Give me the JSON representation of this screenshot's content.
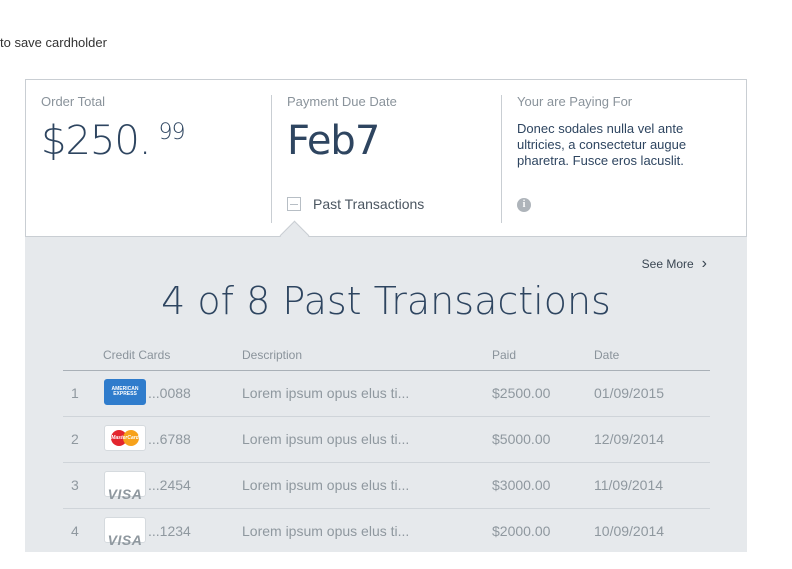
{
  "top_note": "to save cardholder",
  "summary": {
    "order_total_label": "Order Total",
    "order_total_main": "$250.",
    "order_total_cents": "99",
    "due_label": "Payment Due Date",
    "due_value": "Feb7",
    "past_toggle_label": "Past Transactions",
    "paying_label": "Your are Paying For",
    "paying_text": "Donec sodales nulla vel ante ultricies, a consectetur augue pharetra. Fusce eros lacuslit.",
    "info_icon": "info-icon",
    "info_glyph": "i"
  },
  "history": {
    "see_more": "See More",
    "see_more_chevron": ">",
    "title": "4 of 8 Past Transactions",
    "columns": [
      "Credit Cards",
      "Description",
      "Paid",
      "Date"
    ],
    "rows": [
      {
        "num": "1",
        "card": "amex",
        "card_text": "AMERICAN EXPRESS",
        "digits": "...0088",
        "desc": "Lorem ipsum opus elus ti...",
        "paid": "$2500.00",
        "date": "01/09/2015"
      },
      {
        "num": "2",
        "card": "mastercard",
        "card_text": "MasterCard",
        "digits": "...6788",
        "desc": "Lorem ipsum opus elus ti...",
        "paid": "$5000.00",
        "date": "12/09/2014"
      },
      {
        "num": "3",
        "card": "visa",
        "card_text": "VISA",
        "digits": "...2454",
        "desc": "Lorem ipsum opus elus ti...",
        "paid": "$3000.00",
        "date": "11/09/2014"
      },
      {
        "num": "4",
        "card": "visa",
        "card_text": "VISA",
        "digits": "...1234",
        "desc": "Lorem ipsum opus elus ti...",
        "paid": "$2000.00",
        "date": "10/09/2014"
      }
    ]
  },
  "colors": {
    "panel_bg": "#e6e9ec",
    "heading": "#2e4560",
    "muted": "#8f989f",
    "border": "#c9ced3"
  }
}
